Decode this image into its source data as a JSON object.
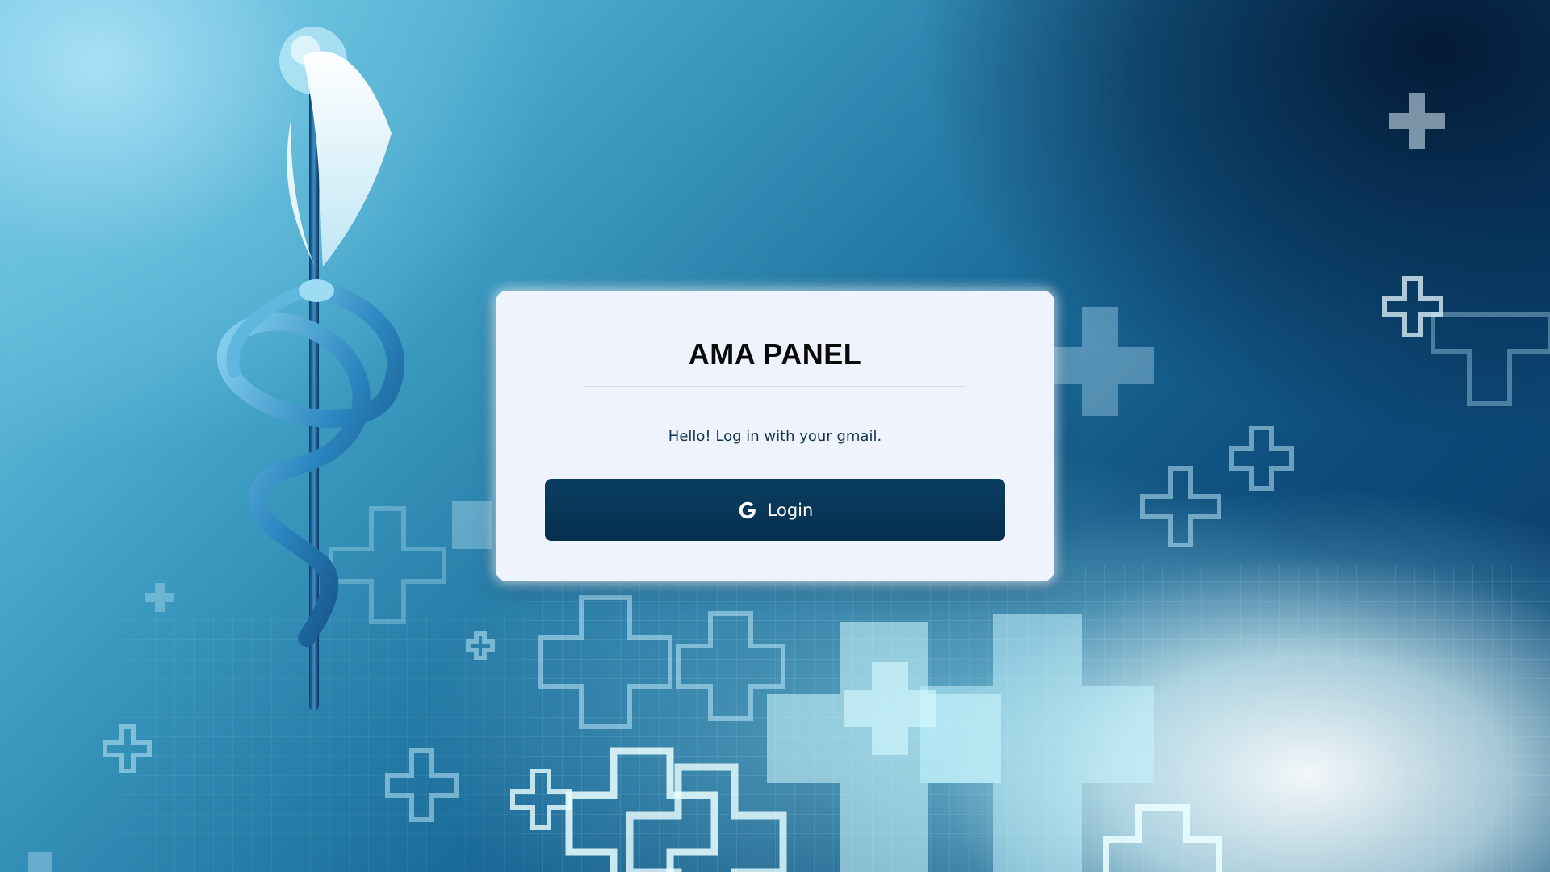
{
  "panel": {
    "title": "AMA PANEL",
    "subtitle": "Hello! Log in with your gmail.",
    "login_button": {
      "label": "Login",
      "icon": "google-icon"
    }
  },
  "background": {
    "description_icon": "caduceus-icon",
    "decorations": "medical-cross-icons"
  },
  "colors": {
    "card_background": "#eef3fd",
    "button_background": "#0a3e62",
    "button_text": "#ffffff",
    "title_text": "#0a0a0a",
    "subtitle_text": "#12344f"
  }
}
